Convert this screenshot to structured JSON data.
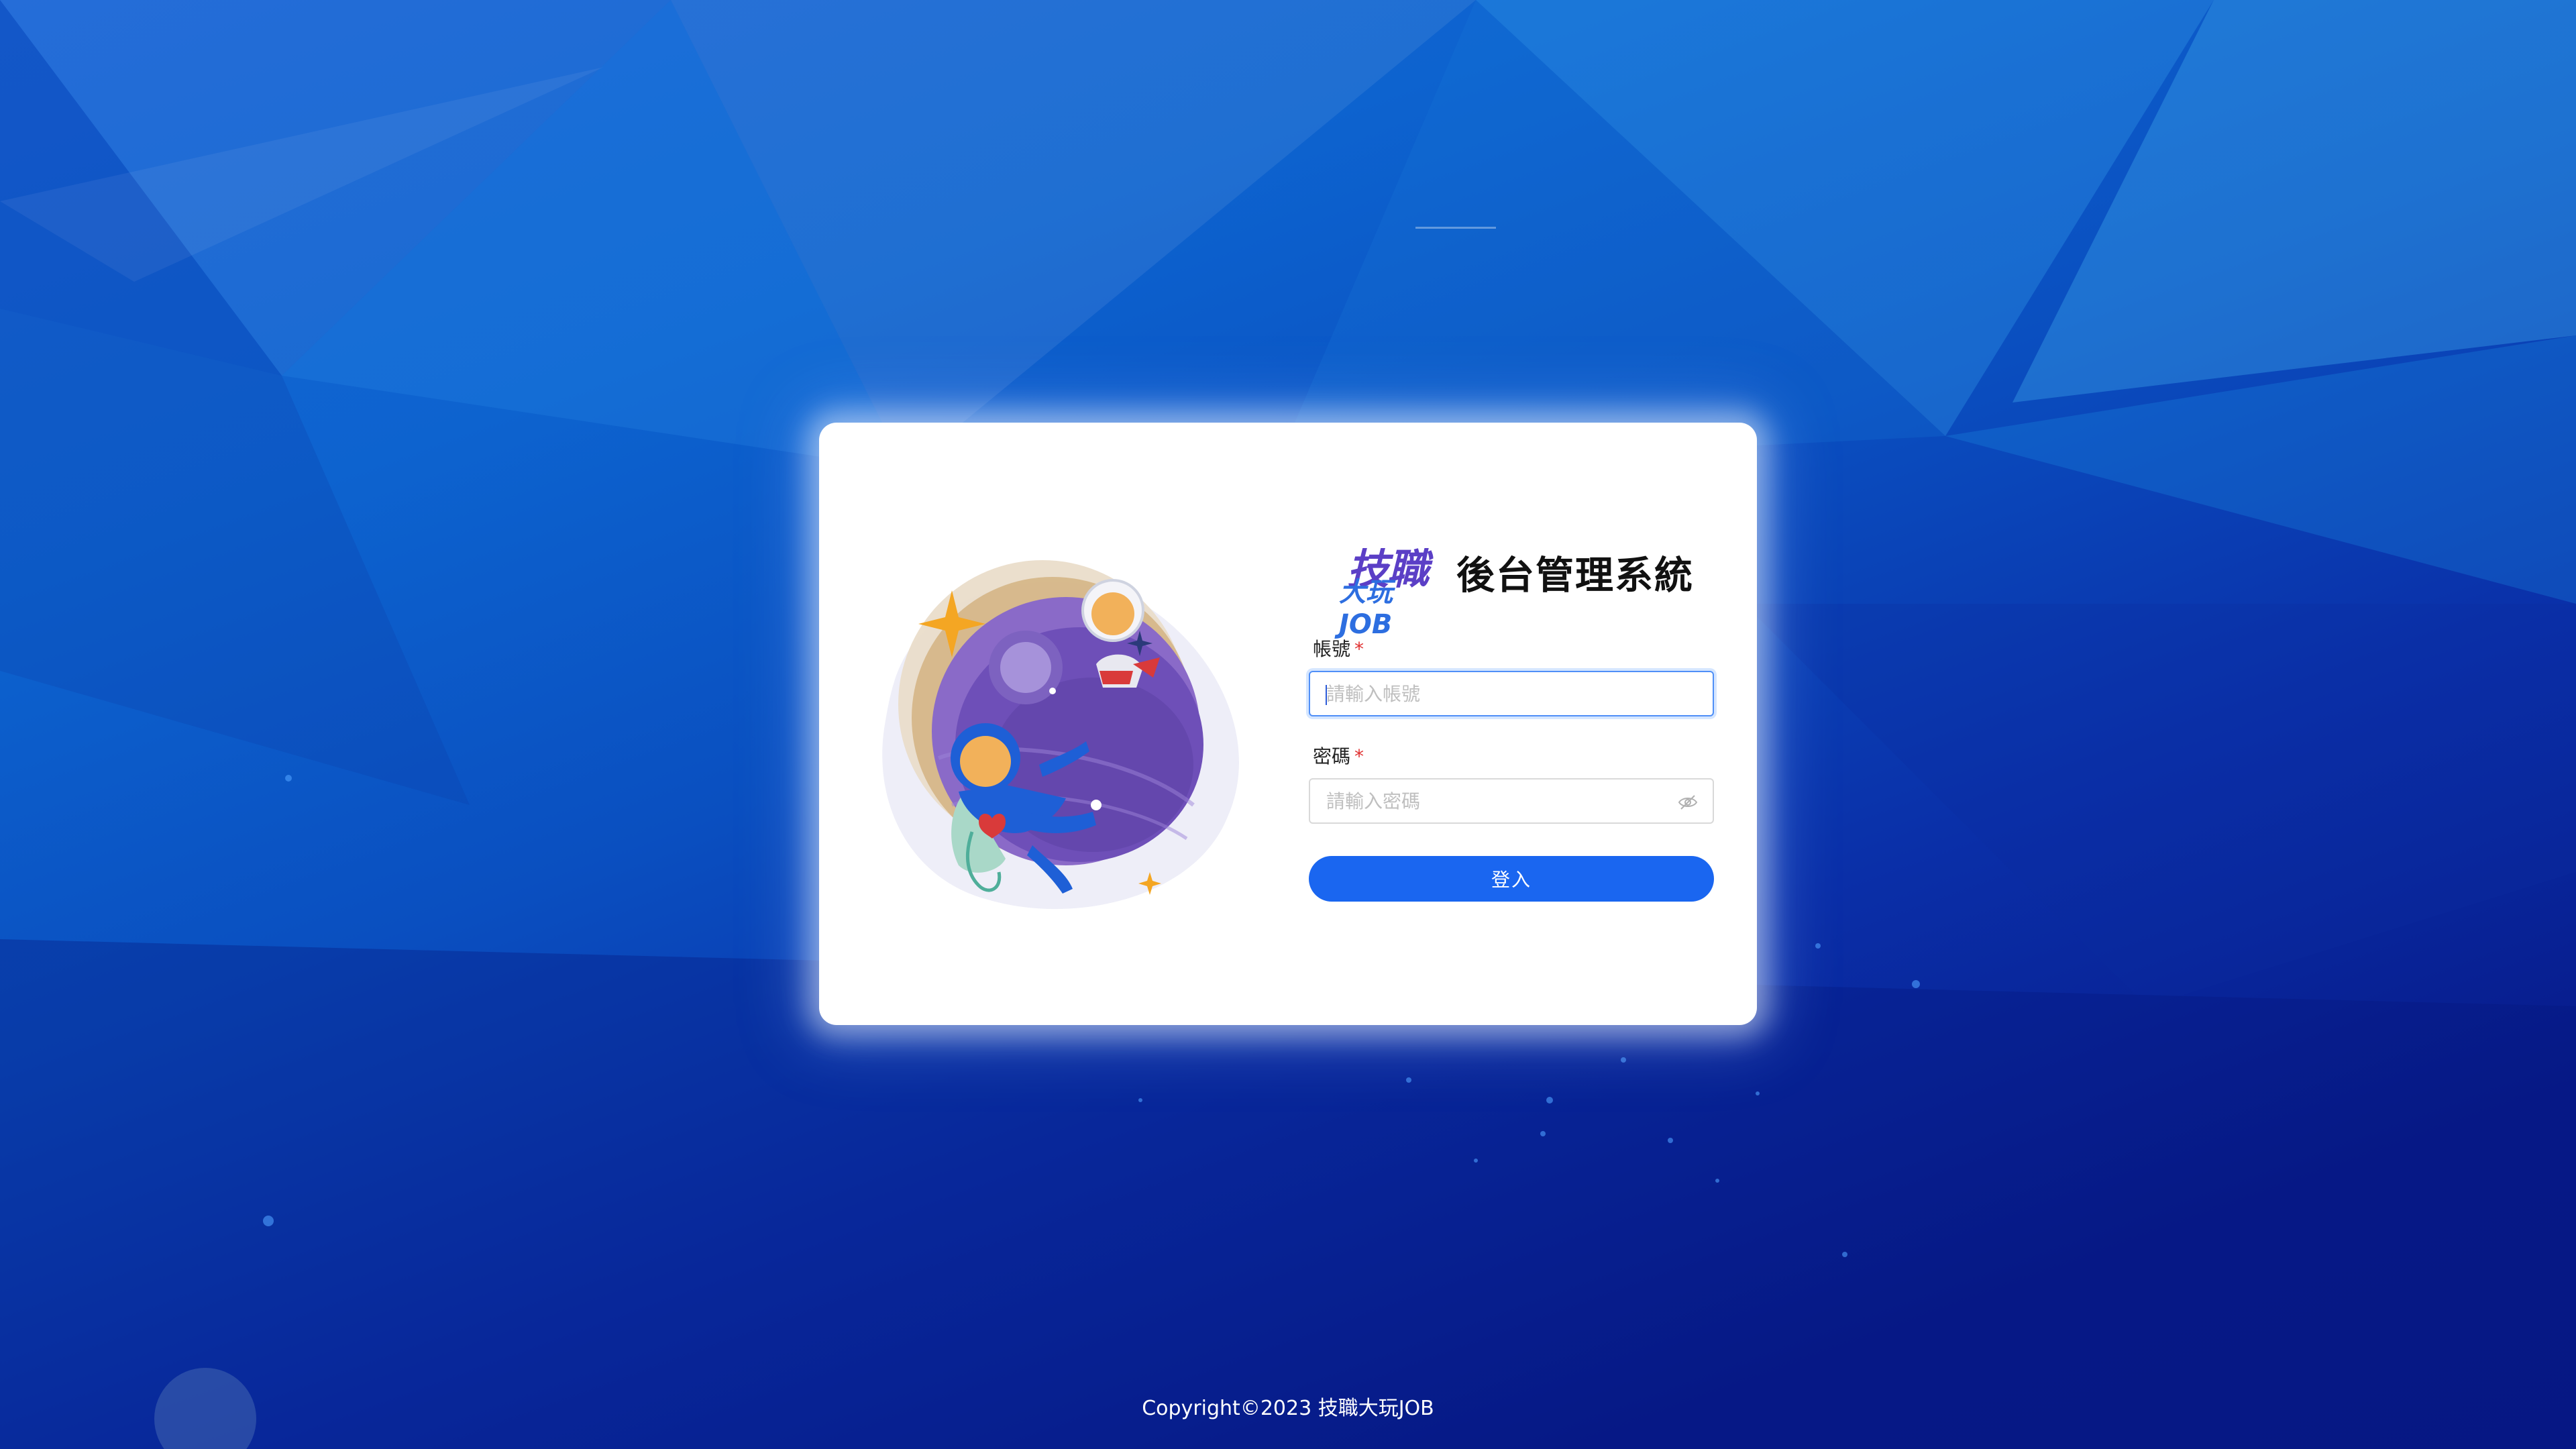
{
  "app": {
    "title": "後台管理系統",
    "logo_text_top": "技職",
    "logo_text_bottom": "大玩JOB"
  },
  "form": {
    "account": {
      "label": "帳號",
      "required_mark": "*",
      "placeholder": "請輸入帳號",
      "value": ""
    },
    "password": {
      "label": "密碼",
      "required_mark": "*",
      "placeholder": "請輸入密碼",
      "value": "",
      "toggle_icon": "eye-off-icon"
    },
    "submit_label": "登入"
  },
  "footer": {
    "copyright": "Copyright©2023 技職大玩JOB"
  },
  "colors": {
    "primary": "#1a66f0",
    "required": "#e03030",
    "focus_border": "#4f8ff7"
  }
}
